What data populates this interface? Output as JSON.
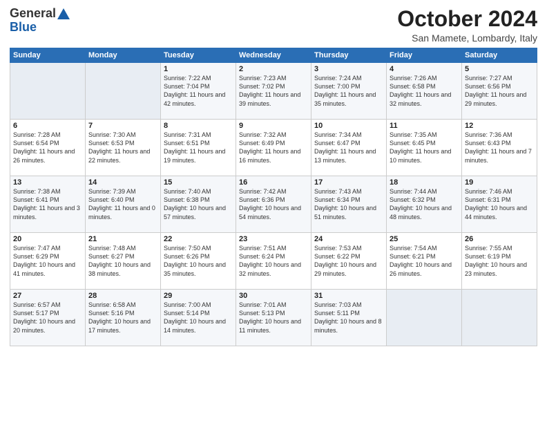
{
  "header": {
    "logo_general": "General",
    "logo_blue": "Blue",
    "title": "October 2024",
    "location": "San Mamete, Lombardy, Italy"
  },
  "weekdays": [
    "Sunday",
    "Monday",
    "Tuesday",
    "Wednesday",
    "Thursday",
    "Friday",
    "Saturday"
  ],
  "weeks": [
    [
      {
        "day": "",
        "info": ""
      },
      {
        "day": "",
        "info": ""
      },
      {
        "day": "1",
        "info": "Sunrise: 7:22 AM\nSunset: 7:04 PM\nDaylight: 11 hours and 42 minutes."
      },
      {
        "day": "2",
        "info": "Sunrise: 7:23 AM\nSunset: 7:02 PM\nDaylight: 11 hours and 39 minutes."
      },
      {
        "day": "3",
        "info": "Sunrise: 7:24 AM\nSunset: 7:00 PM\nDaylight: 11 hours and 35 minutes."
      },
      {
        "day": "4",
        "info": "Sunrise: 7:26 AM\nSunset: 6:58 PM\nDaylight: 11 hours and 32 minutes."
      },
      {
        "day": "5",
        "info": "Sunrise: 7:27 AM\nSunset: 6:56 PM\nDaylight: 11 hours and 29 minutes."
      }
    ],
    [
      {
        "day": "6",
        "info": "Sunrise: 7:28 AM\nSunset: 6:54 PM\nDaylight: 11 hours and 26 minutes."
      },
      {
        "day": "7",
        "info": "Sunrise: 7:30 AM\nSunset: 6:53 PM\nDaylight: 11 hours and 22 minutes."
      },
      {
        "day": "8",
        "info": "Sunrise: 7:31 AM\nSunset: 6:51 PM\nDaylight: 11 hours and 19 minutes."
      },
      {
        "day": "9",
        "info": "Sunrise: 7:32 AM\nSunset: 6:49 PM\nDaylight: 11 hours and 16 minutes."
      },
      {
        "day": "10",
        "info": "Sunrise: 7:34 AM\nSunset: 6:47 PM\nDaylight: 11 hours and 13 minutes."
      },
      {
        "day": "11",
        "info": "Sunrise: 7:35 AM\nSunset: 6:45 PM\nDaylight: 11 hours and 10 minutes."
      },
      {
        "day": "12",
        "info": "Sunrise: 7:36 AM\nSunset: 6:43 PM\nDaylight: 11 hours and 7 minutes."
      }
    ],
    [
      {
        "day": "13",
        "info": "Sunrise: 7:38 AM\nSunset: 6:41 PM\nDaylight: 11 hours and 3 minutes."
      },
      {
        "day": "14",
        "info": "Sunrise: 7:39 AM\nSunset: 6:40 PM\nDaylight: 11 hours and 0 minutes."
      },
      {
        "day": "15",
        "info": "Sunrise: 7:40 AM\nSunset: 6:38 PM\nDaylight: 10 hours and 57 minutes."
      },
      {
        "day": "16",
        "info": "Sunrise: 7:42 AM\nSunset: 6:36 PM\nDaylight: 10 hours and 54 minutes."
      },
      {
        "day": "17",
        "info": "Sunrise: 7:43 AM\nSunset: 6:34 PM\nDaylight: 10 hours and 51 minutes."
      },
      {
        "day": "18",
        "info": "Sunrise: 7:44 AM\nSunset: 6:32 PM\nDaylight: 10 hours and 48 minutes."
      },
      {
        "day": "19",
        "info": "Sunrise: 7:46 AM\nSunset: 6:31 PM\nDaylight: 10 hours and 44 minutes."
      }
    ],
    [
      {
        "day": "20",
        "info": "Sunrise: 7:47 AM\nSunset: 6:29 PM\nDaylight: 10 hours and 41 minutes."
      },
      {
        "day": "21",
        "info": "Sunrise: 7:48 AM\nSunset: 6:27 PM\nDaylight: 10 hours and 38 minutes."
      },
      {
        "day": "22",
        "info": "Sunrise: 7:50 AM\nSunset: 6:26 PM\nDaylight: 10 hours and 35 minutes."
      },
      {
        "day": "23",
        "info": "Sunrise: 7:51 AM\nSunset: 6:24 PM\nDaylight: 10 hours and 32 minutes."
      },
      {
        "day": "24",
        "info": "Sunrise: 7:53 AM\nSunset: 6:22 PM\nDaylight: 10 hours and 29 minutes."
      },
      {
        "day": "25",
        "info": "Sunrise: 7:54 AM\nSunset: 6:21 PM\nDaylight: 10 hours and 26 minutes."
      },
      {
        "day": "26",
        "info": "Sunrise: 7:55 AM\nSunset: 6:19 PM\nDaylight: 10 hours and 23 minutes."
      }
    ],
    [
      {
        "day": "27",
        "info": "Sunrise: 6:57 AM\nSunset: 5:17 PM\nDaylight: 10 hours and 20 minutes."
      },
      {
        "day": "28",
        "info": "Sunrise: 6:58 AM\nSunset: 5:16 PM\nDaylight: 10 hours and 17 minutes."
      },
      {
        "day": "29",
        "info": "Sunrise: 7:00 AM\nSunset: 5:14 PM\nDaylight: 10 hours and 14 minutes."
      },
      {
        "day": "30",
        "info": "Sunrise: 7:01 AM\nSunset: 5:13 PM\nDaylight: 10 hours and 11 minutes."
      },
      {
        "day": "31",
        "info": "Sunrise: 7:03 AM\nSunset: 5:11 PM\nDaylight: 10 hours and 8 minutes."
      },
      {
        "day": "",
        "info": ""
      },
      {
        "day": "",
        "info": ""
      }
    ]
  ]
}
